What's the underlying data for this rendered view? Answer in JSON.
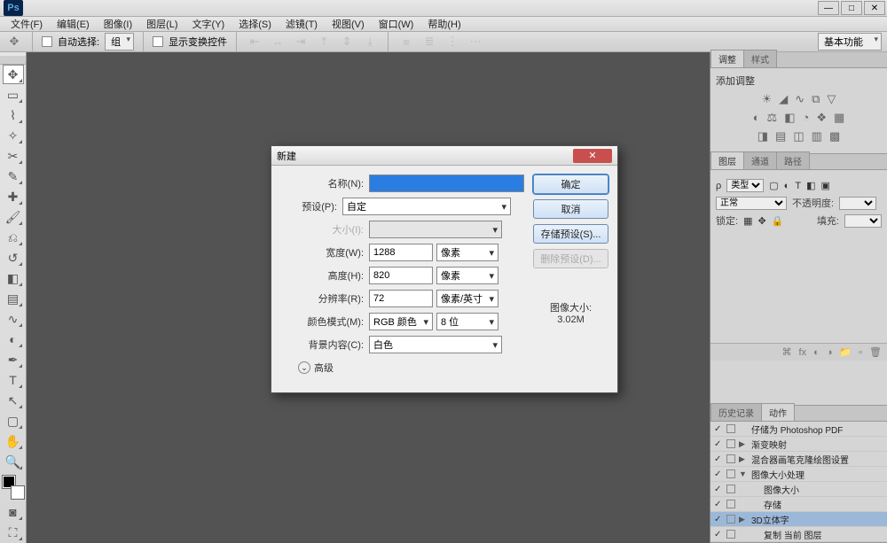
{
  "app_logo": "Ps",
  "menu": [
    "文件(F)",
    "编辑(E)",
    "图像(I)",
    "图层(L)",
    "文字(Y)",
    "选择(S)",
    "滤镜(T)",
    "视图(V)",
    "窗口(W)",
    "帮助(H)"
  ],
  "options": {
    "auto_select": "自动选择:",
    "group": "组",
    "show_transform": "显示变换控件",
    "workspace": "基本功能"
  },
  "panels": {
    "adjust_tabs": [
      "调整",
      "样式"
    ],
    "adjust_title": "添加调整",
    "layer_tabs": [
      "图层",
      "通道",
      "路径"
    ],
    "layer": {
      "kind": "类型",
      "blend": "正常",
      "opacity_label": "不透明度:",
      "lock_label": "锁定:",
      "fill_label": "填充:"
    },
    "history_tabs": [
      "历史记录",
      "动作"
    ],
    "actions": [
      {
        "tog": "",
        "txt": "仔储为 Photoshop PDF"
      },
      {
        "tog": "▶",
        "txt": "渐变映射"
      },
      {
        "tog": "▶",
        "txt": "混合器画笔克隆绘图设置"
      },
      {
        "tog": "▼",
        "txt": "图像大小处理"
      },
      {
        "tog": "",
        "txt": "图像大小",
        "indent": true
      },
      {
        "tog": "",
        "txt": "存储",
        "indent": true
      },
      {
        "tog": "▶",
        "txt": "3D立体字",
        "sel": true
      },
      {
        "tog": "",
        "txt": "复制 当前 图层",
        "indent": true
      }
    ]
  },
  "dialog": {
    "title": "新建",
    "name_label": "名称(N):",
    "name_value": "",
    "preset_label": "预设(P):",
    "preset_value": "自定",
    "size_label": "大小(I):",
    "width_label": "宽度(W):",
    "width_value": "1288",
    "height_label": "高度(H):",
    "height_value": "820",
    "unit_px": "像素",
    "res_label": "分辨率(R):",
    "res_value": "72",
    "res_unit": "像素/英寸",
    "mode_label": "颜色模式(M):",
    "mode_value": "RGB 颜色",
    "depth": "8 位",
    "bg_label": "背景内容(C):",
    "bg_value": "白色",
    "advanced": "高级",
    "ok": "确定",
    "cancel": "取消",
    "save_preset": "存储预设(S)...",
    "delete_preset": "删除预设(D)...",
    "imgsize_label": "图像大小:",
    "imgsize_value": "3.02M"
  }
}
